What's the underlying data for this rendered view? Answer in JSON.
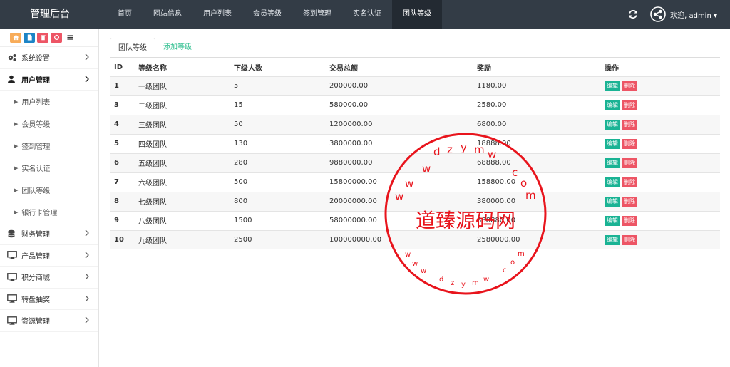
{
  "app": {
    "title": "管理后台"
  },
  "topnav": {
    "items": [
      {
        "label": "首页"
      },
      {
        "label": "网站信息"
      },
      {
        "label": "用户列表"
      },
      {
        "label": "会员等级"
      },
      {
        "label": "签到管理"
      },
      {
        "label": "实名认证"
      },
      {
        "label": "团队等级"
      }
    ],
    "active_index": 6
  },
  "user_menu": {
    "label": "欢迎, admin ▾"
  },
  "sidebar": {
    "tools": [
      {
        "icon": "home-icon",
        "color": "#f8ac59"
      },
      {
        "icon": "file-icon",
        "color": "#1c84c6"
      },
      {
        "icon": "trash-icon",
        "color": "#ed5565"
      },
      {
        "icon": "recycle-icon",
        "color": "#ed5565"
      },
      {
        "icon": "list-icon",
        "color": "#ffffff"
      }
    ],
    "menus": [
      {
        "label": "系统设置",
        "icon": "gears-icon"
      },
      {
        "label": "用户管理",
        "icon": "user-icon"
      },
      {
        "label": "用户列表"
      },
      {
        "label": "会员等级"
      },
      {
        "label": "签到管理"
      },
      {
        "label": "实名认证"
      },
      {
        "label": "团队等级"
      },
      {
        "label": "银行卡管理"
      },
      {
        "label": "财务管理",
        "icon": "database-icon"
      },
      {
        "label": "产品管理",
        "icon": "desktop-icon"
      },
      {
        "label": "积分商城",
        "icon": "desktop-icon"
      },
      {
        "label": "转盘抽奖",
        "icon": "desktop-icon"
      },
      {
        "label": "资源管理",
        "icon": "desktop-icon"
      }
    ]
  },
  "tabs": [
    {
      "label": "团队等级"
    },
    {
      "label": "添加等级"
    }
  ],
  "table": {
    "headers": [
      "ID",
      "等级名称",
      "下级人数",
      "交易总额",
      "奖励",
      "操作"
    ],
    "rows": [
      [
        "1",
        "一级团队",
        "5",
        "200000.00",
        "1180.00"
      ],
      [
        "3",
        "二级团队",
        "15",
        "580000.00",
        "2580.00"
      ],
      [
        "4",
        "三级团队",
        "50",
        "1200000.00",
        "6800.00"
      ],
      [
        "5",
        "四级团队",
        "130",
        "3800000.00",
        "18888.00"
      ],
      [
        "6",
        "五级团队",
        "280",
        "9880000.00",
        "68888.00"
      ],
      [
        "7",
        "六级团队",
        "500",
        "15800000.00",
        "158800.00"
      ],
      [
        "8",
        "七级团队",
        "800",
        "20000000.00",
        "380000.00"
      ],
      [
        "9",
        "八级团队",
        "1500",
        "58000000.00",
        "888880.00"
      ],
      [
        "10",
        "九级团队",
        "2500",
        "100000000.00",
        "2580000.00"
      ]
    ],
    "actions": {
      "edit": "编辑",
      "delete": "删除"
    }
  },
  "watermark": {
    "center_text": "道臻源码网",
    "top_arc": "w w w . d z y m w . c o m",
    "bottom_arc": "w w w . d z y m w . c o m",
    "color": "#e8141c"
  }
}
